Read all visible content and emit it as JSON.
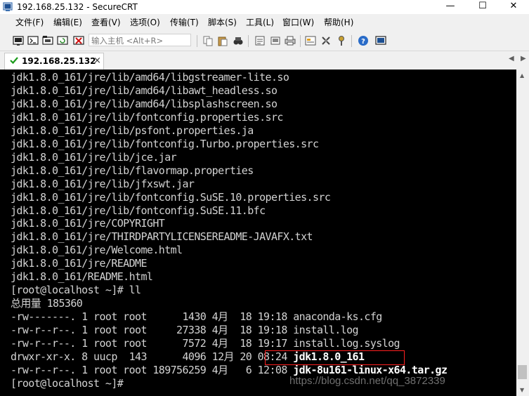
{
  "window": {
    "title": "192.168.25.132 - SecureCRT",
    "minimize": "—",
    "maximize": "☐",
    "close": "✕"
  },
  "menu": [
    "文件(F)",
    "编辑(E)",
    "查看(V)",
    "选项(O)",
    "传输(T)",
    "脚本(S)",
    "工具(L)",
    "窗口(W)",
    "帮助(H)"
  ],
  "toolbar": {
    "quick_connect_placeholder": "输入主机 <Alt+R>"
  },
  "tab": {
    "label": "192.168.25.132",
    "close": "×",
    "nav_left": "◀",
    "nav_right": "▶"
  },
  "terminal": {
    "lines": [
      "jdk1.8.0_161/jre/lib/amd64/libgstreamer-lite.so",
      "jdk1.8.0_161/jre/lib/amd64/libawt_headless.so",
      "jdk1.8.0_161/jre/lib/amd64/libsplashscreen.so",
      "jdk1.8.0_161/jre/lib/fontconfig.properties.src",
      "jdk1.8.0_161/jre/lib/psfont.properties.ja",
      "jdk1.8.0_161/jre/lib/fontconfig.Turbo.properties.src",
      "jdk1.8.0_161/jre/lib/jce.jar",
      "jdk1.8.0_161/jre/lib/flavormap.properties",
      "jdk1.8.0_161/jre/lib/jfxswt.jar",
      "jdk1.8.0_161/jre/lib/fontconfig.SuSE.10.properties.src",
      "jdk1.8.0_161/jre/lib/fontconfig.SuSE.11.bfc",
      "jdk1.8.0_161/jre/COPYRIGHT",
      "jdk1.8.0_161/jre/THIRDPARTYLICENSEREADME-JAVAFX.txt",
      "jdk1.8.0_161/jre/Welcome.html",
      "jdk1.8.0_161/jre/README",
      "jdk1.8.0_161/README.html",
      "[root@localhost ~]# ll",
      "总用量 185360"
    ],
    "listing": [
      {
        "prefix": "-rw-------. 1 root root      1430 4月  18 19:18 ",
        "name": "anaconda-ks.cfg",
        "bold": false
      },
      {
        "prefix": "-rw-r--r--. 1 root root     27338 4月  18 19:18 ",
        "name": "install.log",
        "bold": false
      },
      {
        "prefix": "-rw-r--r--. 1 root root      7572 4月  18 19:17 ",
        "name": "install.log.syslog",
        "bold": false
      },
      {
        "prefix": "drwxr-xr-x. 8 uucp  143      4096 12月 20 08:24 ",
        "name": "jdk1.8.0_161",
        "bold": true
      },
      {
        "prefix": "-rw-r--r--. 1 root root 189756259 4月   6 12:08 ",
        "name": "jdk-8u161-linux-x64.tar.gz",
        "bold": true
      }
    ],
    "prompt": "[root@localhost ~]# "
  },
  "watermark": "https://blog.csdn.net/qq_3872339",
  "colors": {
    "terminal_bg": "#000000",
    "terminal_fg": "#d2d2d2",
    "highlight": "#ff2020"
  }
}
